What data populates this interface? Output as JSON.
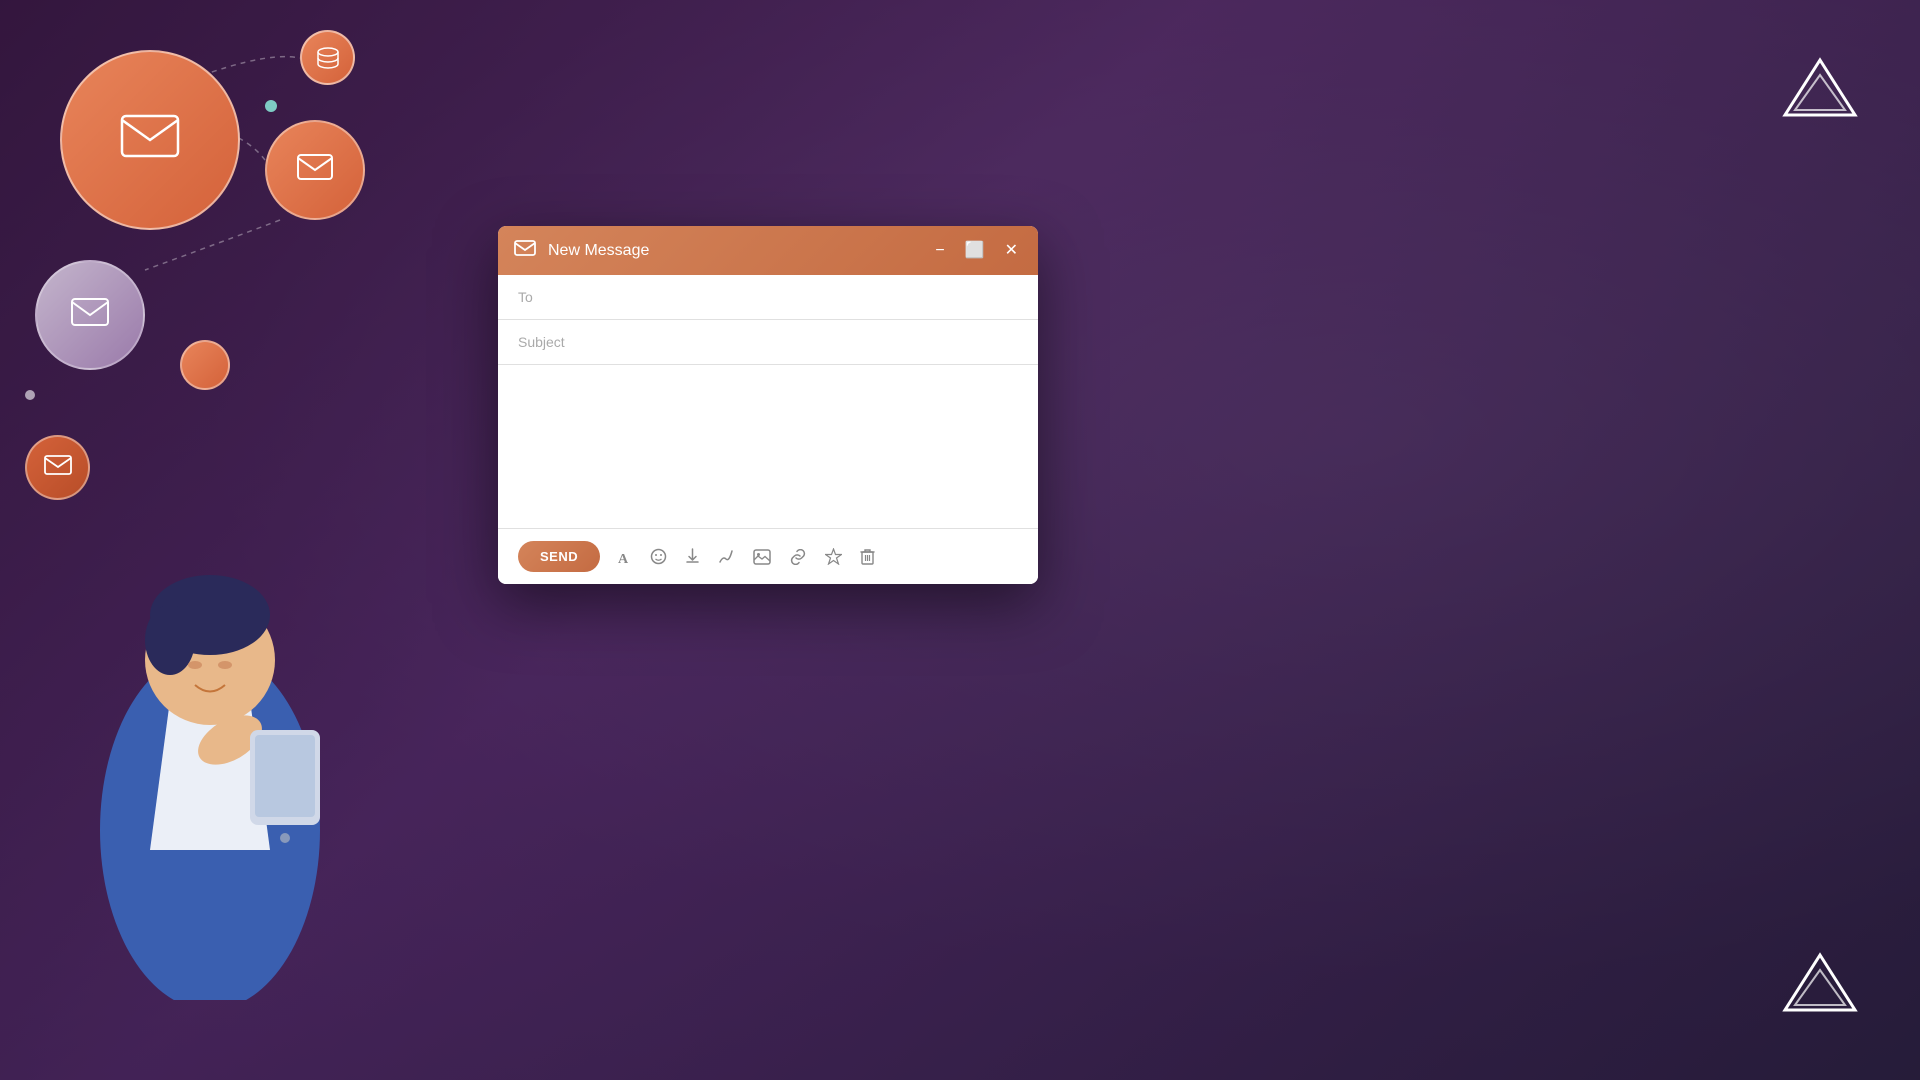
{
  "background": {
    "color": "#2a1a35"
  },
  "illustration": {
    "circles": [
      {
        "id": "large",
        "size": "large"
      },
      {
        "id": "medium",
        "size": "medium"
      },
      {
        "id": "small",
        "size": "small"
      }
    ]
  },
  "brand": {
    "logo_top": "▲",
    "logo_bottom": "▲"
  },
  "compose": {
    "title": "New Message",
    "title_icon": "✉",
    "to_placeholder": "To",
    "subject_placeholder": "Subject",
    "message_placeholder": "",
    "send_label": "SEND",
    "toolbar_icons": [
      {
        "id": "font",
        "symbol": "A",
        "title": "Font"
      },
      {
        "id": "emoji",
        "symbol": "☺",
        "title": "Emoji"
      },
      {
        "id": "attach",
        "symbol": "↓",
        "title": "Attach"
      },
      {
        "id": "signature",
        "symbol": "✒",
        "title": "Signature"
      },
      {
        "id": "image",
        "symbol": "🖼",
        "title": "Image"
      },
      {
        "id": "link",
        "symbol": "🔗",
        "title": "Link"
      },
      {
        "id": "star",
        "symbol": "☆",
        "title": "Star"
      },
      {
        "id": "trash",
        "symbol": "🗑",
        "title": "Trash"
      }
    ],
    "window_controls": {
      "minimize": "−",
      "maximize": "⬜",
      "close": "✕"
    }
  }
}
